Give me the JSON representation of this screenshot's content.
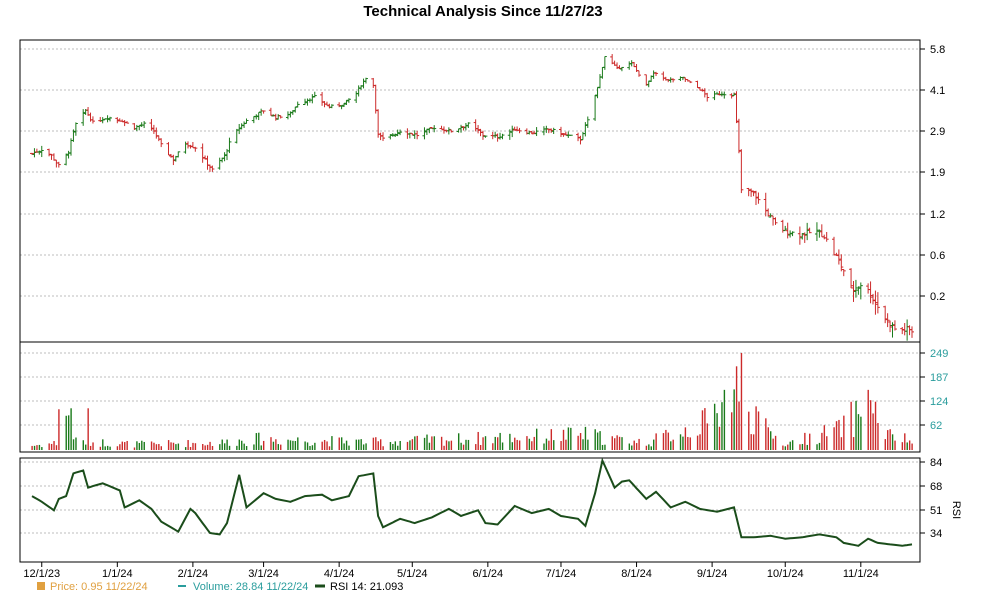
{
  "chart_data": {
    "type": "candlestick",
    "title": "Technical Analysis Since 11/27/23",
    "x_ticks": [
      "12/1/23",
      "1/1/24",
      "2/1/24",
      "3/1/24",
      "4/1/24",
      "5/1/24",
      "6/1/24",
      "7/1/24",
      "8/1/24",
      "9/1/24",
      "10/1/24",
      "11/1/24"
    ],
    "x_start": "2023-11-27",
    "x_end": "2024-11-22",
    "price_ticks": [
      "5.8",
      "4.1",
      "2.9",
      "1.9",
      "1.2",
      "0.6",
      "0.2"
    ],
    "volume_ticks": [
      "249",
      "187",
      "124",
      "62"
    ],
    "rsi_ticks": [
      "84",
      "68",
      "51",
      "34"
    ],
    "rsi_axis_label": "RSI",
    "price_anchors": [
      [
        "2023-11-27",
        2.35
      ],
      [
        "2023-12-01",
        2.45
      ],
      [
        "2023-12-05",
        2.3
      ],
      [
        "2023-12-08",
        2.05
      ],
      [
        "2023-12-12",
        2.4
      ],
      [
        "2023-12-15",
        3.1
      ],
      [
        "2023-12-19",
        3.5
      ],
      [
        "2023-12-22",
        3.15
      ],
      [
        "2023-12-28",
        3.3
      ],
      [
        "2024-01-03",
        3.2
      ],
      [
        "2024-01-08",
        3.0
      ],
      [
        "2024-01-12",
        3.1
      ],
      [
        "2024-01-16",
        2.9
      ],
      [
        "2024-01-19",
        2.55
      ],
      [
        "2024-01-24",
        2.2
      ],
      [
        "2024-01-29",
        2.6
      ],
      [
        "2024-02-02",
        2.5
      ],
      [
        "2024-02-07",
        2.1
      ],
      [
        "2024-02-09",
        1.95
      ],
      [
        "2024-02-14",
        2.3
      ],
      [
        "2024-02-16",
        2.6
      ],
      [
        "2024-02-20",
        3.0
      ],
      [
        "2024-02-23",
        3.2
      ],
      [
        "2024-03-01",
        3.5
      ],
      [
        "2024-03-06",
        3.3
      ],
      [
        "2024-03-12",
        3.4
      ],
      [
        "2024-03-15",
        3.7
      ],
      [
        "2024-03-22",
        3.9
      ],
      [
        "2024-03-28",
        3.6
      ],
      [
        "2024-04-03",
        3.7
      ],
      [
        "2024-04-08",
        4.0
      ],
      [
        "2024-04-12",
        4.6
      ],
      [
        "2024-04-15",
        4.3
      ],
      [
        "2024-04-17",
        2.8
      ],
      [
        "2024-04-19",
        2.7
      ],
      [
        "2024-04-26",
        2.9
      ],
      [
        "2024-05-03",
        2.8
      ],
      [
        "2024-05-10",
        3.0
      ],
      [
        "2024-05-17",
        2.9
      ],
      [
        "2024-05-24",
        3.1
      ],
      [
        "2024-05-30",
        2.8
      ],
      [
        "2024-06-05",
        2.75
      ],
      [
        "2024-06-12",
        2.95
      ],
      [
        "2024-06-19",
        2.85
      ],
      [
        "2024-06-26",
        2.95
      ],
      [
        "2024-07-03",
        2.8
      ],
      [
        "2024-07-09",
        2.7
      ],
      [
        "2024-07-12",
        3.2
      ],
      [
        "2024-07-16",
        4.2
      ],
      [
        "2024-07-19",
        5.5
      ],
      [
        "2024-07-24",
        5.0
      ],
      [
        "2024-07-30",
        5.2
      ],
      [
        "2024-08-05",
        4.3
      ],
      [
        "2024-08-08",
        4.8
      ],
      [
        "2024-08-14",
        4.5
      ],
      [
        "2024-08-20",
        4.6
      ],
      [
        "2024-08-26",
        4.2
      ],
      [
        "2024-08-30",
        3.9
      ],
      [
        "2024-09-05",
        4.0
      ],
      [
        "2024-09-10",
        3.95
      ],
      [
        "2024-09-13",
        1.6
      ],
      [
        "2024-09-18",
        1.55
      ],
      [
        "2024-09-23",
        1.25
      ],
      [
        "2024-09-27",
        1.05
      ],
      [
        "2024-10-01",
        0.95
      ],
      [
        "2024-10-07",
        0.9
      ],
      [
        "2024-10-14",
        0.95
      ],
      [
        "2024-10-17",
        0.88
      ],
      [
        "2024-10-21",
        0.62
      ],
      [
        "2024-10-25",
        0.45
      ],
      [
        "2024-10-28",
        0.25
      ],
      [
        "2024-11-01",
        0.32
      ],
      [
        "2024-11-05",
        0.22
      ],
      [
        "2024-11-08",
        0.1
      ],
      [
        "2024-11-12",
        -0.05
      ],
      [
        "2024-11-15",
        -0.12
      ],
      [
        "2024-11-22",
        -0.14
      ]
    ],
    "volume_anchors": [
      [
        "2023-11-27",
        6
      ],
      [
        "2023-12-08",
        10
      ],
      [
        "2023-12-11",
        50
      ],
      [
        "2023-12-15",
        12
      ],
      [
        "2024-01-08",
        8
      ],
      [
        "2024-02-12",
        10
      ],
      [
        "2024-02-27",
        15
      ],
      [
        "2024-04-15",
        11
      ],
      [
        "2024-07-12",
        21
      ],
      [
        "2024-07-19",
        16
      ],
      [
        "2024-08-05",
        10
      ],
      [
        "2024-08-30",
        38
      ],
      [
        "2024-09-13",
        100
      ],
      [
        "2024-09-18",
        40
      ],
      [
        "2024-10-01",
        8
      ],
      [
        "2024-10-21",
        26
      ],
      [
        "2024-11-05",
        60
      ],
      [
        "2024-11-12",
        20
      ],
      [
        "2024-11-22",
        12
      ]
    ],
    "volume_spikes": [
      [
        "2023-12-08",
        42
      ],
      [
        "2023-12-13",
        43
      ],
      [
        "2023-12-20",
        43
      ],
      [
        "2024-09-12",
        50
      ],
      [
        "2024-09-13",
        100
      ],
      [
        "2024-09-19",
        45
      ],
      [
        "2024-10-23",
        31
      ],
      [
        "2024-11-04",
        62
      ],
      [
        "2024-09-03",
        38
      ]
    ],
    "rsi_anchors": [
      [
        "2023-11-27",
        60
      ],
      [
        "2023-12-01",
        56
      ],
      [
        "2023-12-06",
        50
      ],
      [
        "2023-12-08",
        58
      ],
      [
        "2023-12-11",
        60
      ],
      [
        "2023-12-14",
        76
      ],
      [
        "2023-12-18",
        78
      ],
      [
        "2023-12-20",
        66
      ],
      [
        "2023-12-26",
        69
      ],
      [
        "2024-01-02",
        64
      ],
      [
        "2024-01-04",
        52
      ],
      [
        "2024-01-10",
        57
      ],
      [
        "2024-01-15",
        51
      ],
      [
        "2024-01-19",
        42
      ],
      [
        "2024-01-26",
        35
      ],
      [
        "2024-01-31",
        51
      ],
      [
        "2024-02-02",
        48
      ],
      [
        "2024-02-08",
        34
      ],
      [
        "2024-02-12",
        33
      ],
      [
        "2024-02-15",
        41
      ],
      [
        "2024-02-20",
        75
      ],
      [
        "2024-02-23",
        52
      ],
      [
        "2024-03-01",
        62
      ],
      [
        "2024-03-06",
        58
      ],
      [
        "2024-03-12",
        56
      ],
      [
        "2024-03-18",
        60
      ],
      [
        "2024-03-25",
        61
      ],
      [
        "2024-03-29",
        57
      ],
      [
        "2024-04-05",
        60
      ],
      [
        "2024-04-09",
        74
      ],
      [
        "2024-04-15",
        76
      ],
      [
        "2024-04-17",
        46
      ],
      [
        "2024-04-19",
        38
      ],
      [
        "2024-04-26",
        44
      ],
      [
        "2024-05-02",
        41
      ],
      [
        "2024-05-09",
        45
      ],
      [
        "2024-05-16",
        51
      ],
      [
        "2024-05-21",
        46
      ],
      [
        "2024-05-28",
        50
      ],
      [
        "2024-05-31",
        41
      ],
      [
        "2024-06-05",
        40
      ],
      [
        "2024-06-12",
        53
      ],
      [
        "2024-06-19",
        48
      ],
      [
        "2024-06-26",
        51
      ],
      [
        "2024-07-01",
        46
      ],
      [
        "2024-07-08",
        44
      ],
      [
        "2024-07-11",
        39
      ],
      [
        "2024-07-15",
        62
      ],
      [
        "2024-07-18",
        85
      ],
      [
        "2024-07-23",
        66
      ],
      [
        "2024-07-28",
        73
      ],
      [
        "2024-08-05",
        58
      ],
      [
        "2024-08-09",
        63
      ],
      [
        "2024-08-15",
        52
      ],
      [
        "2024-08-21",
        56
      ],
      [
        "2024-08-27",
        51
      ],
      [
        "2024-09-03",
        49
      ],
      [
        "2024-09-10",
        52
      ],
      [
        "2024-09-13",
        31
      ],
      [
        "2024-09-18",
        31
      ],
      [
        "2024-09-25",
        32
      ],
      [
        "2024-10-01",
        30
      ],
      [
        "2024-10-08",
        31
      ],
      [
        "2024-10-15",
        33
      ],
      [
        "2024-10-22",
        31
      ],
      [
        "2024-10-25",
        27
      ],
      [
        "2024-10-31",
        25
      ],
      [
        "2024-11-04",
        30
      ],
      [
        "2024-11-08",
        27
      ],
      [
        "2024-11-13",
        26
      ],
      [
        "2024-11-18",
        25
      ],
      [
        "2024-11-22",
        26
      ]
    ],
    "colors": {
      "up": "#1a7a1a",
      "down": "#cc2a2a",
      "rsi": "#1b4d1b",
      "volume_label": "#2a9d9d",
      "price_label": "#e0a040"
    }
  },
  "legend": {
    "price": "Price: 0.95  11/22/24",
    "volume": "Volume: 28.84  11/22/24",
    "rsi": "RSI 14: 21.093"
  }
}
